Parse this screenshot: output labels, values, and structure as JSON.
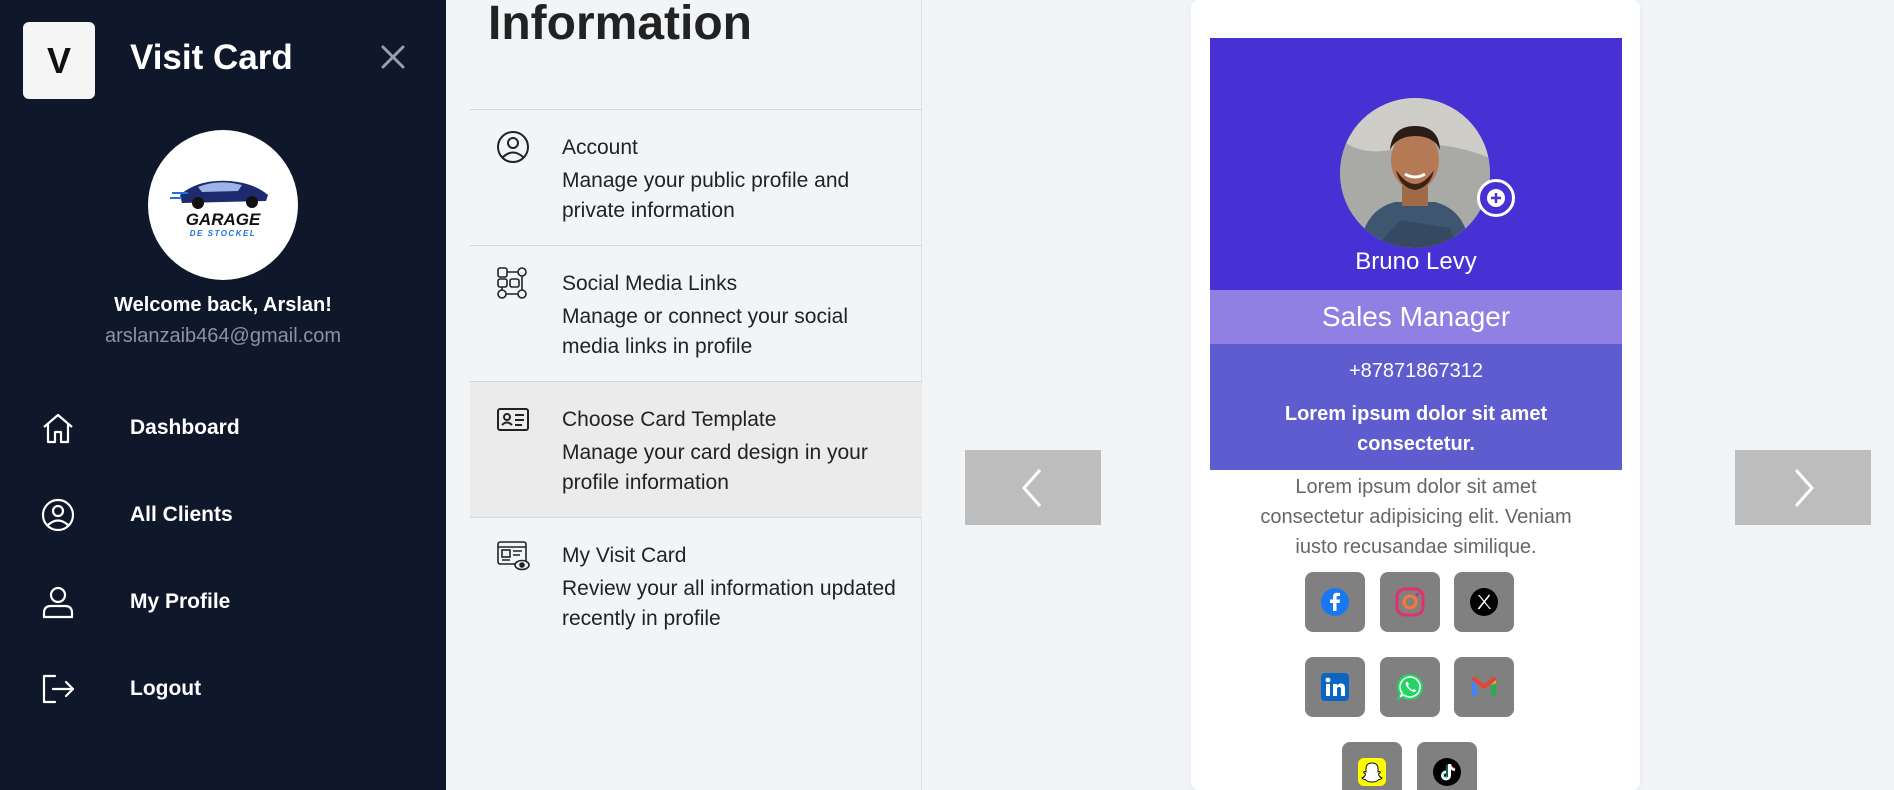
{
  "sidebar": {
    "logo_letter": "V",
    "app_title": "Visit Card",
    "company_logo": {
      "line1": "GARAGE",
      "line2": "DE STOCKEL"
    },
    "welcome": "Welcome back, Arslan!",
    "email": "arslanzaib464@gmail.com",
    "nav": [
      {
        "label": "Dashboard",
        "icon": "home-icon"
      },
      {
        "label": "All Clients",
        "icon": "user-circle-icon"
      },
      {
        "label": "My Profile",
        "icon": "user-icon"
      },
      {
        "label": "Logout",
        "icon": "logout-icon"
      }
    ]
  },
  "info": {
    "title": "Information",
    "items": [
      {
        "title": "Account",
        "desc": "Manage your public profile and private information",
        "icon": "user-circle-icon"
      },
      {
        "title": "Social Media Links",
        "desc": "Manage or connect your social media links in profile",
        "icon": "social-links-icon"
      },
      {
        "title": "Choose Card Template",
        "desc": "Manage your card design in your profile information",
        "icon": "id-card-icon",
        "active": true
      },
      {
        "title": "My Visit Card",
        "desc": "Review your all information updated recently in profile",
        "icon": "visit-card-view-icon"
      }
    ]
  },
  "card": {
    "name": "Bruno Levy",
    "role": "Sales Manager",
    "phone": "+87871867312",
    "tagline": "Lorem ipsum dolor sit amet consectetur.",
    "bio": "Lorem ipsum dolor sit amet consectetur adipisicing elit. Veniam iusto recusandae similique.",
    "colors": {
      "primary": "#4731d4",
      "role_band": "#9080e4",
      "info_band": "#5e5ccf"
    },
    "socials": [
      "facebook-icon",
      "instagram-icon",
      "x-icon",
      "linkedin-icon",
      "whatsapp-icon",
      "gmail-icon",
      "snapchat-icon",
      "tiktok-icon"
    ]
  },
  "carousel": {
    "prev_icon": "chevron-left-icon",
    "next_icon": "chevron-right-icon"
  },
  "colors": {
    "sidebar_bg": "#0f172a",
    "page_bg": "#f2f5f8",
    "arrow_bg": "#bdbdbd"
  }
}
